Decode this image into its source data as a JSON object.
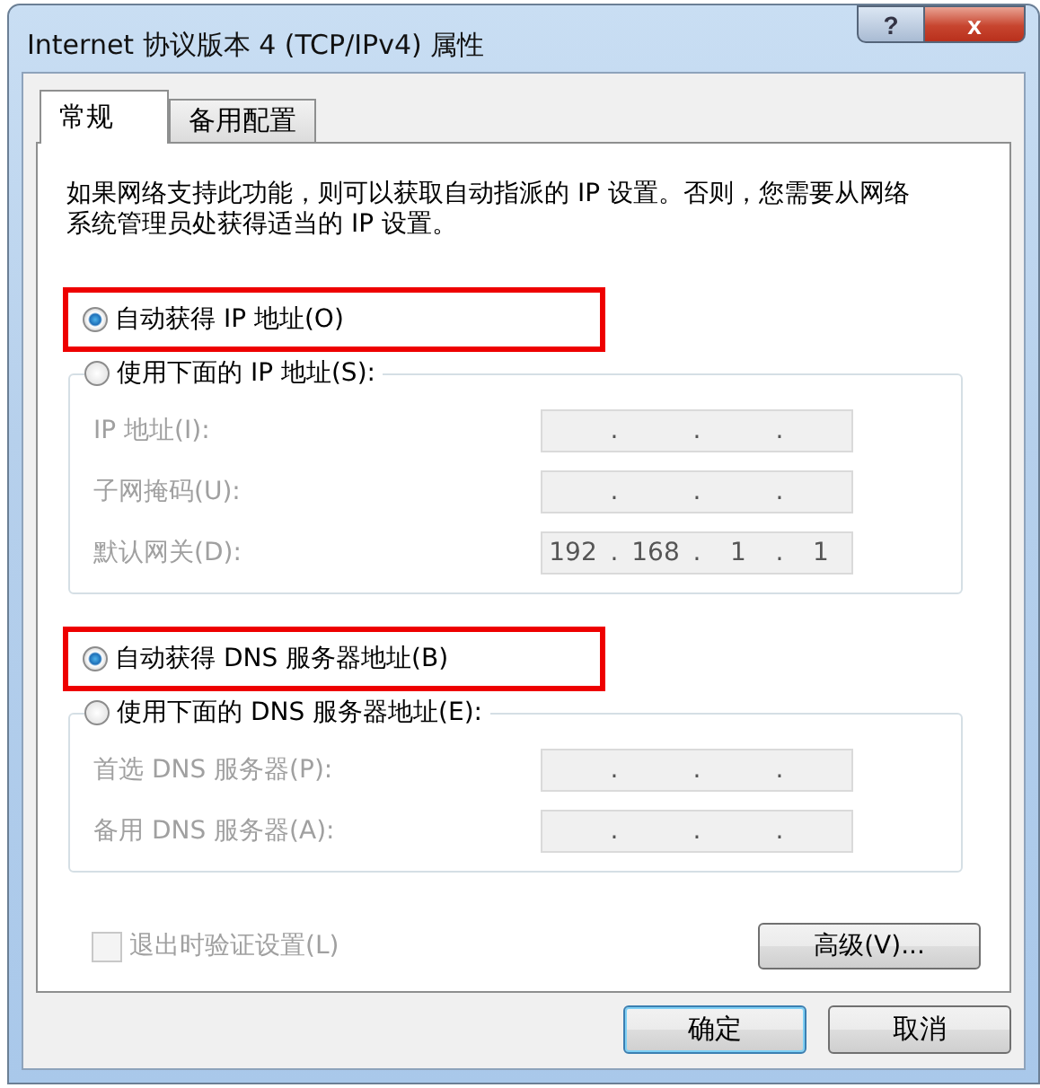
{
  "window": {
    "title": "Internet 协议版本 4 (TCP/IPv4) 属性",
    "buttons": [
      {
        "kind": "help",
        "label": "?"
      },
      {
        "kind": "close",
        "label": "x"
      }
    ]
  },
  "tabs": [
    {
      "label": "常规",
      "selected": true
    },
    {
      "label": "备用配置",
      "selected": false
    }
  ],
  "description": "如果网络支持此功能，则可以获取自动指派的 IP 设置。否则，您需要从网络系统管理员处获得适当的 IP 设置。",
  "sections": [
    {
      "auto": {
        "label": "自动获得 IP 地址(O)",
        "selected": true,
        "highlighted": true
      },
      "manual": {
        "label": "使用下面的 IP 地址(S):",
        "selected": false
      },
      "fields": [
        {
          "label": "IP 地址(I):",
          "disabled": true,
          "separators": [
            ".",
            ".",
            "."
          ]
        },
        {
          "label": "子网掩码(U):",
          "disabled": true,
          "separators": [
            ".",
            ".",
            "."
          ]
        },
        {
          "label": "默认网关(D):",
          "disabled": true,
          "octets": [
            "192",
            "168",
            "1",
            "1"
          ],
          "separators": [
            ".",
            ".",
            "."
          ]
        }
      ]
    },
    {
      "auto": {
        "label": "自动获得 DNS 服务器地址(B)",
        "selected": true,
        "highlighted": true
      },
      "manual": {
        "label": "使用下面的 DNS 服务器地址(E):",
        "selected": false
      },
      "fields": [
        {
          "label": "首选 DNS 服务器(P):",
          "disabled": true,
          "separators": [
            ".",
            ".",
            "."
          ]
        },
        {
          "label": "备用 DNS 服务器(A):",
          "disabled": true,
          "separators": [
            ".",
            ".",
            "."
          ]
        }
      ]
    }
  ],
  "validate_checkbox": {
    "label": "退出时验证设置(L)",
    "checked": false,
    "disabled": true
  },
  "advanced_button": "高级(V)...",
  "buttons": [
    {
      "label": "确定",
      "default": true
    },
    {
      "label": "取消",
      "default": false
    }
  ]
}
